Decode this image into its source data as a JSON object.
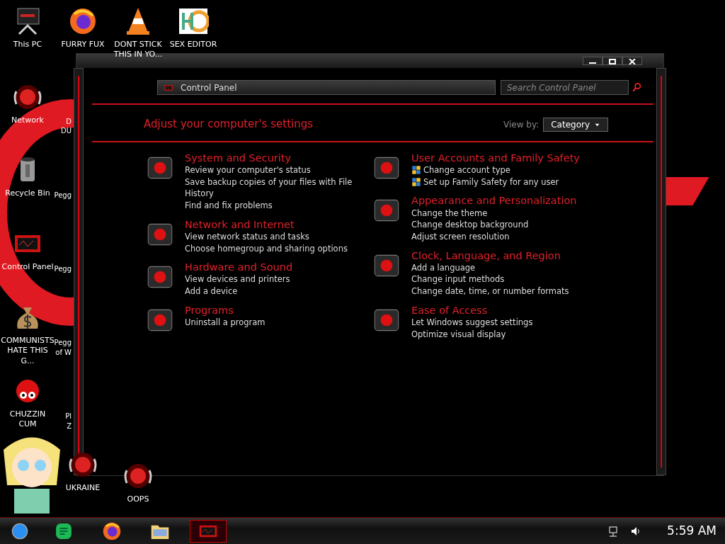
{
  "desktop_icons": [
    {
      "label": "This PC",
      "kind": "pc"
    },
    {
      "label": "FURRY FUX",
      "kind": "browser"
    },
    {
      "label": "DONT STICK THIS IN YO...",
      "kind": "cone"
    },
    {
      "label": "SEX EDITOR",
      "kind": "hex"
    },
    {
      "label": "Network",
      "kind": "orb"
    },
    {
      "label": "Recycle Bin",
      "kind": "bin"
    },
    {
      "label": "Control Panel",
      "kind": "panel"
    },
    {
      "label": "COMMUNISTS HATE THIS G...",
      "kind": "money"
    },
    {
      "label": "CHUZZIN CUM",
      "kind": "fuzz"
    },
    {
      "label": "UKRAINE",
      "kind": "orb"
    },
    {
      "label": "OOPS",
      "kind": "orb"
    }
  ],
  "partial_labels": [
    "D",
    "DU",
    "Pegg",
    "Pegg",
    "Pegg",
    "of W",
    "Pl",
    "Z"
  ],
  "window": {
    "breadcrumb": "Control Panel",
    "search": {
      "placeholder": "Search Control Panel"
    },
    "heading": "Adjust your computer's settings",
    "view_by": {
      "label": "View by:",
      "value": "Category"
    },
    "columns": [
      [
        {
          "title": "System and Security",
          "links": [
            {
              "text": "Review your computer's status",
              "shield": false
            },
            {
              "text": "Save backup copies of your files with File History",
              "shield": false
            },
            {
              "text": "Find and fix problems",
              "shield": false
            }
          ]
        },
        {
          "title": "Network and Internet",
          "links": [
            {
              "text": "View network status and tasks",
              "shield": false
            },
            {
              "text": "Choose homegroup and sharing options",
              "shield": false
            }
          ]
        },
        {
          "title": "Hardware and Sound",
          "links": [
            {
              "text": "View devices and printers",
              "shield": false
            },
            {
              "text": "Add a device",
              "shield": false
            }
          ]
        },
        {
          "title": "Programs",
          "links": [
            {
              "text": "Uninstall a program",
              "shield": false
            }
          ]
        }
      ],
      [
        {
          "title": "User Accounts and Family Safety",
          "links": [
            {
              "text": "Change account type",
              "shield": true
            },
            {
              "text": "Set up Family Safety for any user",
              "shield": true
            }
          ]
        },
        {
          "title": "Appearance and Personalization",
          "links": [
            {
              "text": "Change the theme",
              "shield": false
            },
            {
              "text": "Change desktop background",
              "shield": false
            },
            {
              "text": "Adjust screen resolution",
              "shield": false
            }
          ]
        },
        {
          "title": "Clock, Language, and Region",
          "links": [
            {
              "text": "Add a language",
              "shield": false
            },
            {
              "text": "Change input methods",
              "shield": false
            },
            {
              "text": "Change date, time, or number formats",
              "shield": false
            }
          ]
        },
        {
          "title": "Ease of Access",
          "links": [
            {
              "text": "Let Windows suggest settings",
              "shield": false
            },
            {
              "text": "Optimize visual display",
              "shield": false
            }
          ]
        }
      ]
    ]
  },
  "taskbar": {
    "apps": [
      {
        "kind": "notes",
        "active": false
      },
      {
        "kind": "browser",
        "active": false
      },
      {
        "kind": "folder",
        "active": false
      },
      {
        "kind": "panel",
        "active": true
      }
    ],
    "clock": "5:59 AM"
  }
}
